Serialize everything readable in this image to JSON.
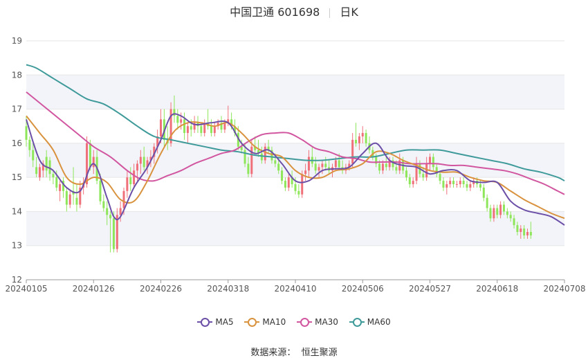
{
  "header": {
    "name": "中国卫通 601698",
    "period": "日K"
  },
  "source": "数据来源：  恒生聚源",
  "colors": {
    "up": "#f0707a",
    "down": "#8ee65a",
    "ma5": "#6c4fa7",
    "ma10": "#d9923e",
    "ma30": "#d1569f",
    "ma60": "#3f9a9a",
    "band": "#f3f4fa",
    "grid": "#e6e6e6"
  },
  "chart_data": {
    "type": "candlestick",
    "ylim": [
      12,
      19
    ],
    "yticks": [
      12,
      13,
      14,
      15,
      16,
      17,
      18,
      19
    ],
    "xticks": [
      "20240105",
      "20240126",
      "20240226",
      "20240318",
      "20240410",
      "20240506",
      "20240527",
      "20240618",
      "20240708"
    ],
    "xtick_index": [
      0,
      20,
      40,
      60,
      80,
      100,
      120,
      140,
      160
    ],
    "n_days": 161,
    "legend": [
      "MA5",
      "MA10",
      "MA30",
      "MA60"
    ],
    "candles": [
      [
        16.5,
        16.8,
        15.9,
        16.1
      ],
      [
        16.1,
        16.2,
        15.6,
        15.8
      ],
      [
        15.8,
        16.0,
        15.3,
        15.5
      ],
      [
        15.3,
        15.6,
        15.0,
        15.1
      ],
      [
        15.0,
        15.4,
        14.9,
        15.3
      ],
      [
        15.2,
        15.5,
        15.0,
        15.4
      ],
      [
        15.6,
        15.8,
        15.0,
        15.2
      ],
      [
        15.5,
        15.6,
        14.9,
        15.1
      ],
      [
        15.1,
        15.2,
        14.8,
        15.0
      ],
      [
        15.0,
        15.2,
        14.6,
        14.7
      ],
      [
        14.6,
        14.9,
        14.3,
        14.8
      ],
      [
        14.9,
        15.0,
        14.4,
        14.6
      ],
      [
        14.6,
        14.7,
        14.0,
        14.2
      ],
      [
        14.2,
        14.6,
        14.1,
        14.5
      ],
      [
        14.6,
        15.3,
        14.2,
        14.5
      ],
      [
        14.4,
        14.8,
        14.0,
        14.2
      ],
      [
        14.2,
        14.9,
        14.1,
        14.7
      ],
      [
        14.7,
        15.0,
        14.5,
        14.8
      ],
      [
        14.8,
        16.2,
        14.7,
        16.0
      ],
      [
        16.0,
        16.1,
        15.2,
        15.3
      ],
      [
        15.3,
        15.8,
        15.1,
        15.6
      ],
      [
        15.6,
        15.8,
        14.8,
        14.9
      ],
      [
        14.9,
        15.1,
        14.2,
        14.3
      ],
      [
        14.3,
        14.5,
        14.0,
        14.1
      ],
      [
        14.1,
        14.3,
        13.6,
        13.9
      ],
      [
        13.9,
        14.0,
        12.8,
        13.8
      ],
      [
        13.8,
        14.0,
        12.8,
        12.9
      ],
      [
        12.9,
        14.1,
        12.8,
        13.9
      ],
      [
        13.9,
        14.3,
        13.7,
        14.1
      ],
      [
        14.1,
        14.7,
        13.9,
        14.6
      ],
      [
        14.6,
        15.2,
        14.4,
        15.0
      ],
      [
        15.0,
        15.3,
        14.6,
        14.8
      ],
      [
        14.8,
        15.4,
        14.7,
        15.2
      ],
      [
        15.2,
        15.5,
        14.9,
        15.4
      ],
      [
        15.4,
        15.8,
        15.1,
        15.6
      ],
      [
        15.6,
        15.9,
        15.2,
        15.3
      ],
      [
        15.3,
        15.6,
        15.1,
        15.5
      ],
      [
        15.5,
        15.8,
        15.3,
        15.6
      ],
      [
        15.6,
        16.0,
        15.4,
        15.9
      ],
      [
        15.9,
        16.4,
        15.7,
        16.2
      ],
      [
        16.2,
        17.0,
        16.0,
        16.7
      ],
      [
        16.7,
        17.0,
        15.9,
        16.1
      ],
      [
        16.1,
        16.5,
        15.8,
        16.0
      ],
      [
        16.0,
        17.2,
        15.9,
        17.0
      ],
      [
        17.0,
        17.4,
        16.6,
        16.8
      ],
      [
        16.8,
        17.0,
        16.4,
        16.6
      ],
      [
        16.6,
        16.9,
        16.4,
        16.7
      ],
      [
        16.7,
        16.9,
        16.1,
        16.3
      ],
      [
        16.3,
        16.6,
        16.0,
        16.5
      ],
      [
        16.5,
        16.7,
        16.2,
        16.4
      ],
      [
        16.4,
        16.8,
        16.3,
        16.6
      ],
      [
        16.6,
        16.8,
        16.3,
        16.5
      ],
      [
        16.5,
        16.6,
        16.2,
        16.3
      ],
      [
        16.3,
        16.7,
        16.2,
        16.6
      ],
      [
        16.6,
        17.0,
        16.4,
        16.5
      ],
      [
        16.5,
        16.7,
        16.2,
        16.3
      ],
      [
        16.3,
        16.6,
        16.2,
        16.5
      ],
      [
        16.5,
        16.7,
        16.4,
        16.6
      ],
      [
        16.6,
        16.8,
        16.3,
        16.4
      ],
      [
        16.4,
        16.7,
        16.3,
        16.6
      ],
      [
        16.6,
        17.1,
        16.5,
        16.7
      ],
      [
        16.7,
        16.9,
        16.4,
        16.5
      ],
      [
        16.5,
        16.7,
        16.2,
        16.3
      ],
      [
        16.3,
        16.5,
        15.8,
        15.9
      ],
      [
        15.9,
        16.1,
        15.7,
        15.8
      ],
      [
        15.8,
        16.0,
        15.3,
        15.4
      ],
      [
        15.4,
        15.6,
        15.0,
        15.1
      ],
      [
        15.1,
        16.1,
        15.0,
        15.9
      ],
      [
        15.9,
        16.2,
        15.7,
        15.8
      ],
      [
        15.8,
        16.1,
        15.6,
        15.7
      ],
      [
        15.7,
        15.9,
        15.4,
        15.5
      ],
      [
        15.5,
        16.0,
        15.4,
        15.9
      ],
      [
        15.9,
        16.1,
        15.7,
        15.8
      ],
      [
        15.8,
        15.9,
        15.4,
        15.5
      ],
      [
        15.5,
        15.7,
        15.3,
        15.4
      ],
      [
        15.4,
        15.6,
        15.1,
        15.2
      ],
      [
        15.2,
        15.3,
        14.8,
        14.9
      ],
      [
        14.9,
        15.0,
        14.6,
        14.7
      ],
      [
        14.7,
        15.1,
        14.6,
        15.0
      ],
      [
        15.0,
        15.2,
        14.7,
        14.8
      ],
      [
        14.8,
        15.0,
        14.5,
        14.6
      ],
      [
        14.6,
        14.8,
        14.4,
        14.5
      ],
      [
        14.5,
        15.2,
        14.4,
        15.1
      ],
      [
        15.1,
        15.4,
        14.9,
        15.2
      ],
      [
        15.2,
        15.8,
        15.0,
        15.6
      ],
      [
        15.6,
        15.9,
        15.3,
        15.4
      ],
      [
        15.4,
        15.6,
        15.1,
        15.2
      ],
      [
        15.2,
        15.4,
        15.0,
        15.3
      ],
      [
        15.3,
        15.5,
        15.1,
        15.4
      ],
      [
        15.4,
        15.6,
        15.2,
        15.3
      ],
      [
        15.3,
        15.5,
        15.1,
        15.2
      ],
      [
        15.2,
        15.4,
        15.0,
        15.3
      ],
      [
        15.3,
        15.6,
        15.2,
        15.5
      ],
      [
        15.5,
        15.7,
        15.2,
        15.3
      ],
      [
        15.3,
        15.5,
        15.1,
        15.2
      ],
      [
        15.2,
        15.4,
        15.1,
        15.3
      ],
      [
        15.3,
        15.5,
        15.2,
        15.4
      ],
      [
        15.4,
        16.3,
        15.3,
        16.1
      ],
      [
        16.1,
        16.6,
        15.9,
        16.0
      ],
      [
        16.0,
        16.3,
        15.8,
        16.2
      ],
      [
        16.2,
        16.5,
        16.0,
        16.3
      ],
      [
        16.3,
        16.4,
        15.9,
        16.0
      ],
      [
        16.0,
        16.2,
        15.7,
        15.8
      ],
      [
        15.8,
        15.9,
        15.5,
        15.6
      ],
      [
        15.6,
        15.7,
        15.3,
        15.4
      ],
      [
        15.4,
        15.5,
        15.1,
        15.2
      ],
      [
        15.2,
        15.5,
        15.1,
        15.4
      ],
      [
        15.4,
        15.6,
        15.2,
        15.3
      ],
      [
        15.3,
        15.6,
        15.2,
        15.5
      ],
      [
        15.5,
        15.6,
        15.2,
        15.3
      ],
      [
        15.3,
        15.5,
        15.1,
        15.2
      ],
      [
        15.2,
        15.7,
        15.1,
        15.5
      ],
      [
        15.5,
        15.6,
        15.1,
        15.2
      ],
      [
        15.2,
        15.3,
        14.9,
        15.0
      ],
      [
        15.0,
        15.1,
        14.7,
        14.8
      ],
      [
        14.8,
        15.0,
        14.7,
        14.9
      ],
      [
        14.9,
        15.6,
        14.8,
        15.4
      ],
      [
        15.4,
        15.5,
        15.0,
        15.1
      ],
      [
        15.1,
        15.3,
        14.9,
        15.0
      ],
      [
        15.0,
        15.6,
        14.9,
        15.4
      ],
      [
        15.4,
        15.7,
        15.2,
        15.6
      ],
      [
        15.6,
        15.7,
        15.2,
        15.3
      ],
      [
        15.3,
        15.4,
        15.0,
        15.1
      ],
      [
        15.1,
        15.2,
        14.8,
        14.9
      ],
      [
        14.9,
        15.0,
        14.6,
        14.7
      ],
      [
        14.7,
        14.9,
        14.5,
        14.8
      ],
      [
        14.8,
        15.0,
        14.7,
        14.9
      ],
      [
        14.9,
        15.0,
        14.7,
        14.8
      ],
      [
        14.8,
        14.9,
        14.7,
        14.8
      ],
      [
        14.8,
        15.0,
        14.7,
        14.9
      ],
      [
        14.9,
        15.0,
        14.7,
        14.8
      ],
      [
        14.8,
        14.9,
        14.6,
        14.7
      ],
      [
        14.7,
        14.9,
        14.6,
        14.8
      ],
      [
        14.8,
        15.0,
        14.7,
        14.9
      ],
      [
        14.9,
        15.0,
        14.7,
        14.8
      ],
      [
        14.8,
        14.9,
        14.6,
        14.7
      ],
      [
        14.7,
        14.8,
        14.3,
        14.4
      ],
      [
        14.4,
        14.5,
        14.0,
        14.1
      ],
      [
        14.1,
        14.2,
        13.7,
        13.8
      ],
      [
        13.8,
        14.2,
        13.7,
        14.1
      ],
      [
        14.1,
        14.2,
        13.8,
        13.9
      ],
      [
        13.9,
        14.3,
        13.8,
        14.2
      ],
      [
        14.2,
        14.3,
        13.9,
        14.0
      ],
      [
        14.0,
        14.1,
        13.8,
        13.9
      ],
      [
        13.9,
        14.0,
        13.7,
        13.8
      ],
      [
        13.8,
        13.9,
        13.5,
        13.6
      ],
      [
        13.6,
        13.7,
        13.3,
        13.4
      ],
      [
        13.4,
        13.6,
        13.2,
        13.5
      ],
      [
        13.5,
        13.6,
        13.2,
        13.3
      ],
      [
        13.3,
        13.5,
        13.2,
        13.4
      ],
      [
        13.4,
        13.7,
        13.2,
        13.3
      ]
    ],
    "ma5": [
      [
        0,
        16.7
      ],
      [
        4,
        15.5
      ],
      [
        8,
        15.2
      ],
      [
        12,
        14.7
      ],
      [
        16,
        14.6
      ],
      [
        20,
        15.4
      ],
      [
        24,
        14.4
      ],
      [
        26,
        13.85
      ],
      [
        28,
        13.85
      ],
      [
        32,
        14.7
      ],
      [
        36,
        15.3
      ],
      [
        40,
        16.1
      ],
      [
        43,
        16.8
      ],
      [
        46,
        16.8
      ],
      [
        50,
        16.55
      ],
      [
        55,
        16.6
      ],
      [
        60,
        16.6
      ],
      [
        64,
        16.0
      ],
      [
        68,
        15.7
      ],
      [
        72,
        15.8
      ],
      [
        76,
        15.4
      ],
      [
        80,
        14.9
      ],
      [
        84,
        14.9
      ],
      [
        88,
        15.2
      ],
      [
        92,
        15.25
      ],
      [
        96,
        15.3
      ],
      [
        100,
        15.7
      ],
      [
        104,
        16.0
      ],
      [
        108,
        15.5
      ],
      [
        112,
        15.35
      ],
      [
        116,
        15.3
      ],
      [
        120,
        15.1
      ],
      [
        124,
        15.2
      ],
      [
        128,
        15.2
      ],
      [
        132,
        14.9
      ],
      [
        136,
        14.85
      ],
      [
        140,
        14.85
      ],
      [
        144,
        14.3
      ],
      [
        148,
        14.05
      ],
      [
        152,
        13.95
      ],
      [
        156,
        13.85
      ],
      [
        160,
        13.6
      ]
    ],
    "ma10": [
      [
        0,
        16.8
      ],
      [
        4,
        16.3
      ],
      [
        8,
        15.8
      ],
      [
        12,
        15.0
      ],
      [
        16,
        14.8
      ],
      [
        20,
        15.0
      ],
      [
        24,
        14.85
      ],
      [
        28,
        14.35
      ],
      [
        32,
        14.3
      ],
      [
        36,
        14.9
      ],
      [
        40,
        15.7
      ],
      [
        44,
        16.35
      ],
      [
        48,
        16.6
      ],
      [
        52,
        16.6
      ],
      [
        56,
        16.5
      ],
      [
        60,
        16.6
      ],
      [
        64,
        16.3
      ],
      [
        68,
        15.9
      ],
      [
        72,
        15.7
      ],
      [
        76,
        15.6
      ],
      [
        80,
        15.2
      ],
      [
        84,
        15.0
      ],
      [
        88,
        15.0
      ],
      [
        92,
        15.2
      ],
      [
        96,
        15.25
      ],
      [
        100,
        15.4
      ],
      [
        104,
        15.75
      ],
      [
        108,
        15.7
      ],
      [
        112,
        15.5
      ],
      [
        116,
        15.35
      ],
      [
        120,
        15.2
      ],
      [
        124,
        15.15
      ],
      [
        128,
        15.15
      ],
      [
        132,
        15.0
      ],
      [
        136,
        14.9
      ],
      [
        140,
        14.85
      ],
      [
        144,
        14.6
      ],
      [
        148,
        14.35
      ],
      [
        152,
        14.15
      ],
      [
        156,
        13.95
      ],
      [
        160,
        13.8
      ]
    ],
    "ma30": [
      [
        0,
        17.5
      ],
      [
        5,
        17.1
      ],
      [
        10,
        16.7
      ],
      [
        15,
        16.3
      ],
      [
        20,
        15.9
      ],
      [
        25,
        15.6
      ],
      [
        30,
        15.2
      ],
      [
        34,
        14.95
      ],
      [
        38,
        14.9
      ],
      [
        42,
        15.05
      ],
      [
        46,
        15.2
      ],
      [
        50,
        15.4
      ],
      [
        54,
        15.55
      ],
      [
        58,
        15.7
      ],
      [
        62,
        15.8
      ],
      [
        66,
        16.05
      ],
      [
        70,
        16.25
      ],
      [
        74,
        16.3
      ],
      [
        78,
        16.3
      ],
      [
        82,
        16.1
      ],
      [
        86,
        15.85
      ],
      [
        90,
        15.75
      ],
      [
        94,
        15.6
      ],
      [
        98,
        15.55
      ],
      [
        102,
        15.45
      ],
      [
        106,
        15.45
      ],
      [
        110,
        15.45
      ],
      [
        114,
        15.4
      ],
      [
        118,
        15.4
      ],
      [
        122,
        15.4
      ],
      [
        126,
        15.35
      ],
      [
        130,
        15.35
      ],
      [
        134,
        15.3
      ],
      [
        138,
        15.25
      ],
      [
        142,
        15.2
      ],
      [
        146,
        15.1
      ],
      [
        150,
        14.95
      ],
      [
        154,
        14.8
      ],
      [
        158,
        14.6
      ],
      [
        160,
        14.5
      ]
    ],
    "ma60": [
      [
        0,
        18.3
      ],
      [
        3,
        18.2
      ],
      [
        8,
        17.9
      ],
      [
        13,
        17.6
      ],
      [
        18,
        17.3
      ],
      [
        23,
        17.15
      ],
      [
        28,
        16.85
      ],
      [
        33,
        16.5
      ],
      [
        38,
        16.2
      ],
      [
        43,
        16.1
      ],
      [
        48,
        16.0
      ],
      [
        53,
        15.9
      ],
      [
        58,
        15.8
      ],
      [
        63,
        15.75
      ],
      [
        68,
        15.65
      ],
      [
        73,
        15.6
      ],
      [
        78,
        15.55
      ],
      [
        83,
        15.5
      ],
      [
        88,
        15.5
      ],
      [
        93,
        15.55
      ],
      [
        98,
        15.6
      ],
      [
        103,
        15.6
      ],
      [
        108,
        15.7
      ],
      [
        113,
        15.8
      ],
      [
        118,
        15.8
      ],
      [
        123,
        15.8
      ],
      [
        128,
        15.7
      ],
      [
        133,
        15.6
      ],
      [
        138,
        15.5
      ],
      [
        143,
        15.4
      ],
      [
        148,
        15.25
      ],
      [
        153,
        15.15
      ],
      [
        158,
        15.0
      ],
      [
        160,
        14.9
      ]
    ]
  }
}
